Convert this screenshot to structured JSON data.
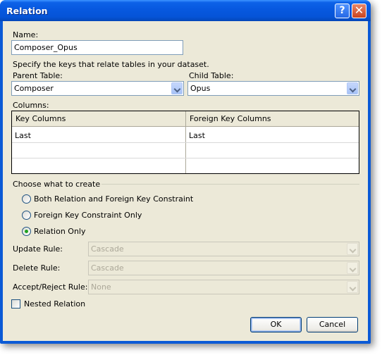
{
  "window": {
    "title": "Relation"
  },
  "name": {
    "label": "Name:",
    "value": "Composer_Opus"
  },
  "description": "Specify the keys that relate tables in your dataset.",
  "parent_table": {
    "label": "Parent Table:",
    "value": "Composer"
  },
  "child_table": {
    "label": "Child Table:",
    "value": "Opus"
  },
  "columns": {
    "label": "Columns:",
    "headers": [
      "Key Columns",
      "Foreign Key Columns"
    ],
    "rows": [
      [
        "Last",
        "Last"
      ],
      [
        "",
        ""
      ],
      [
        "",
        ""
      ]
    ]
  },
  "create": {
    "label": "Choose what to create",
    "options": [
      {
        "label": "Both Relation and Foreign Key Constraint",
        "selected": false
      },
      {
        "label": "Foreign Key Constraint Only",
        "selected": false
      },
      {
        "label": "Relation Only",
        "selected": true
      }
    ]
  },
  "rules": {
    "update": {
      "label": "Update Rule:",
      "value": "Cascade"
    },
    "delete": {
      "label": "Delete Rule:",
      "value": "Cascade"
    },
    "accept_reject": {
      "label": "Accept/Reject Rule:",
      "value": "None"
    }
  },
  "nested": {
    "label": "Nested Relation",
    "checked": false
  },
  "buttons": {
    "ok": "OK",
    "cancel": "Cancel"
  },
  "icons": {
    "help": "help-icon",
    "close": "close-icon"
  },
  "colors": {
    "titlebar": "#0758df",
    "face": "#ece9d8",
    "radio_dot": "#21a121"
  }
}
